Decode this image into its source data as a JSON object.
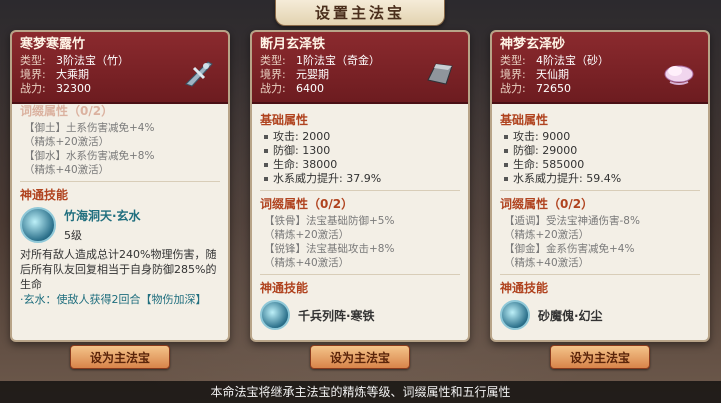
{
  "title": "设置主法宝",
  "cards": [
    {
      "name": "寒梦寒露竹",
      "type_label": "类型:",
      "type_value": "3阶法宝（竹）",
      "realm_label": "境界:",
      "realm_value": "大乘期",
      "power_label": "战力:",
      "power_value": "32300",
      "icon": "bamboo-blade-icon",
      "cut_header": "词缀属性（0/2）",
      "affixes": [
        {
          "line1": "【御土】土系伤害减免+4%",
          "line2": "（精炼+20激活）"
        },
        {
          "line1": "【御水】水系伤害减免+8%",
          "line2": "（精炼+40激活）"
        }
      ],
      "skill_header": "神通技能",
      "skill_name": "竹海洞天·玄水",
      "skill_level": "5级",
      "skill_desc": "对所有敌人造成总计240%物理伤害，随后所有队友回复相当于自身防御285%的生命",
      "skill_extra": "·玄水：使敌人获得2回合【物伤加深】",
      "button": "设为主法宝"
    },
    {
      "name": "断月玄泽铁",
      "type_label": "类型:",
      "type_value": "1阶法宝（奇金）",
      "realm_label": "境界:",
      "realm_value": "元婴期",
      "power_label": "战力:",
      "power_value": "6400",
      "icon": "iron-ingot-icon",
      "base_header": "基础属性",
      "stats": [
        "攻击: 2000",
        "防御: 1300",
        "生命: 38000",
        "水系威力提升: 37.9%"
      ],
      "affix_header": "词缀属性（0/2）",
      "affixes": [
        {
          "line1": "【铁骨】法宝基础防御+5%",
          "line2": "（精炼+20激活）"
        },
        {
          "line1": "【锐锋】法宝基础攻击+8%",
          "line2": "（精炼+40激活）"
        }
      ],
      "skill_header": "神通技能",
      "skill_name": "千兵列阵·寒铁",
      "button": "设为主法宝"
    },
    {
      "name": "神梦玄泽砂",
      "type_label": "类型:",
      "type_value": "4阶法宝（砂）",
      "realm_label": "境界:",
      "realm_value": "天仙期",
      "power_label": "战力:",
      "power_value": "72650",
      "icon": "sand-cloud-icon",
      "base_header": "基础属性",
      "stats": [
        "攻击: 9000",
        "防御: 29000",
        "生命: 585000",
        "水系威力提升: 59.4%"
      ],
      "affix_header": "词缀属性（0/2）",
      "affixes": [
        {
          "line1": "【遁调】受法宝神通伤害-8%",
          "line2": "（精炼+20激活）"
        },
        {
          "line1": "【御金】金系伤害减免+4%",
          "line2": "（精炼+40激活）"
        }
      ],
      "skill_header": "神通技能",
      "skill_name": "砂魔傀·幻尘",
      "button": "设为主法宝"
    }
  ],
  "footer": "本命法宝将继承主法宝的精炼等级、词缀属性和五行属性"
}
